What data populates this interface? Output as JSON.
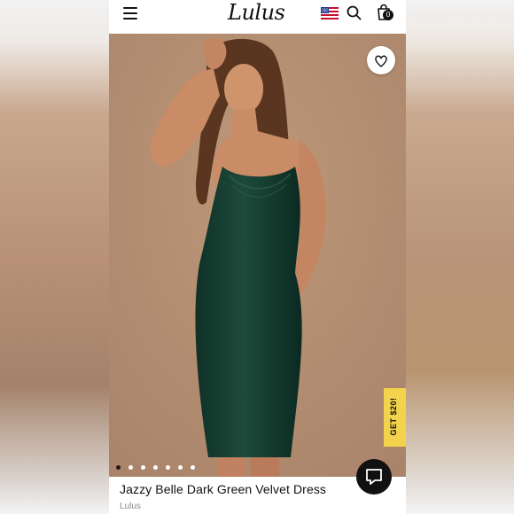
{
  "header": {
    "logo_text": "Lulus",
    "cart_count": "0",
    "icons": [
      "hamburger-menu-icon",
      "us-flag-icon",
      "search-icon",
      "shopping-bag-icon"
    ]
  },
  "hero": {
    "promo_label": "GET $20!",
    "carousel": {
      "total": 7,
      "active": 1
    },
    "colors": {
      "backdrop": "#b38d70",
      "dress": "#143c2f",
      "promo": "#f2d34b"
    }
  },
  "product": {
    "title": "Jazzy Belle Dark Green Velvet Dress",
    "brand": "Lulus"
  },
  "chat": {
    "icon": "chat-bubble-icon"
  }
}
